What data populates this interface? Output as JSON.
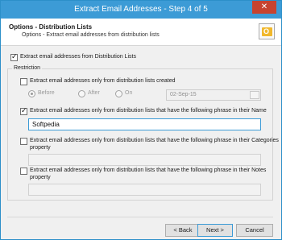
{
  "window": {
    "title": "Extract Email Addresses - Step 4 of 5",
    "close_glyph": "✕"
  },
  "header": {
    "title": "Options - Distribution Lists",
    "subtitle": "Options - Extract email addresses from distribution lists",
    "icon": "outlook-icon"
  },
  "main_option": {
    "label": "Extract email addresses from Distribution Lists",
    "checked": true
  },
  "restriction": {
    "legend": "Restriction",
    "created": {
      "label": "Extract email addresses only from distribution lists created",
      "checked": false,
      "radios": [
        {
          "label": "Before",
          "selected": true
        },
        {
          "label": "After",
          "selected": false
        },
        {
          "label": "On",
          "selected": false
        }
      ],
      "date_value": "02-Sep-15"
    },
    "name_phrase": {
      "label": "Extract email addresses only from distribution lists that have the following phrase in their Name",
      "checked": true,
      "value": "Softpedia"
    },
    "categories_phrase": {
      "label": "Extract email addresses only from distribution lists that have the following phrase in their Categories",
      "label_line2": "property",
      "checked": false,
      "value": ""
    },
    "notes_phrase": {
      "label": "Extract email addresses only from distribution lists that have the following phrase in their Notes",
      "label_line2": "property",
      "checked": false,
      "value": ""
    }
  },
  "buttons": {
    "back": "< Back",
    "next": "Next >",
    "cancel": "Cancel"
  },
  "colors": {
    "titlebar": "#3c9bd6",
    "close": "#c7432f",
    "accent": "#3c9bd6"
  }
}
